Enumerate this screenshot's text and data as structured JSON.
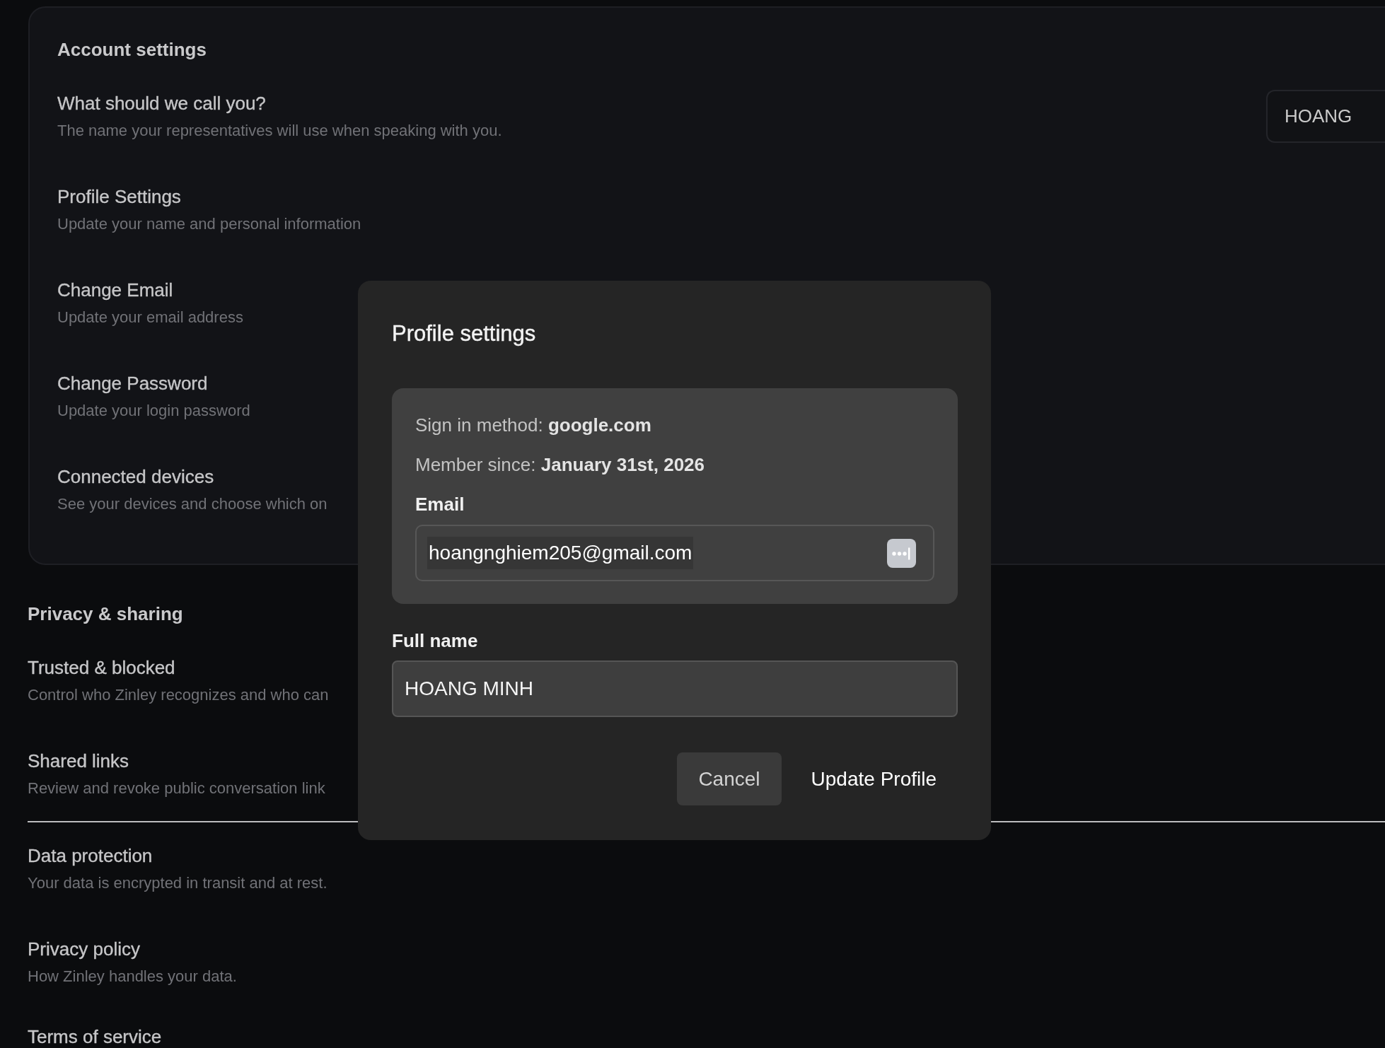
{
  "account_settings": {
    "title": "Account settings",
    "items": [
      {
        "kind": "field",
        "title": "What should we call you?",
        "description": "The name your representatives will use when speaking with you.",
        "value": "HOANG"
      },
      {
        "kind": "link",
        "title": "Profile Settings",
        "description": "Update your name and personal information"
      },
      {
        "kind": "link",
        "title": "Change Email",
        "description": "Update your email address"
      },
      {
        "kind": "link",
        "title": "Change Password",
        "description": "Update your login password"
      },
      {
        "kind": "link",
        "title": "Connected devices",
        "description": "See your devices and choose which on"
      }
    ]
  },
  "privacy_sharing": {
    "title": "Privacy & sharing",
    "groups": [
      {
        "items": [
          {
            "kind": "link",
            "title": "Trusted & blocked",
            "description": "Control who Zinley recognizes and who can"
          },
          {
            "kind": "link",
            "title": "Shared links",
            "description": "Review and revoke public conversation link"
          }
        ]
      },
      {
        "items": [
          {
            "kind": "link",
            "title": "Data protection",
            "description": "Your data is encrypted in transit and at rest."
          },
          {
            "kind": "link",
            "title": "Privacy policy",
            "description": "How Zinley handles your data."
          },
          {
            "kind": "link",
            "title": "Terms of service"
          }
        ]
      }
    ]
  },
  "dialog": {
    "title": "Profile settings",
    "info": [
      "Sign in method: **google.com**",
      "Member since: **January 31st, 2026**"
    ],
    "email": {
      "label": "Email",
      "value": "hoangnghiem205@gmail.com"
    },
    "full_name": {
      "label": "Full name",
      "value": "HOANG MINH"
    },
    "buttons": [
      {
        "kind": "cancel",
        "label": "Cancel"
      },
      {
        "kind": "submit",
        "label": "Update Profile"
      }
    ]
  }
}
